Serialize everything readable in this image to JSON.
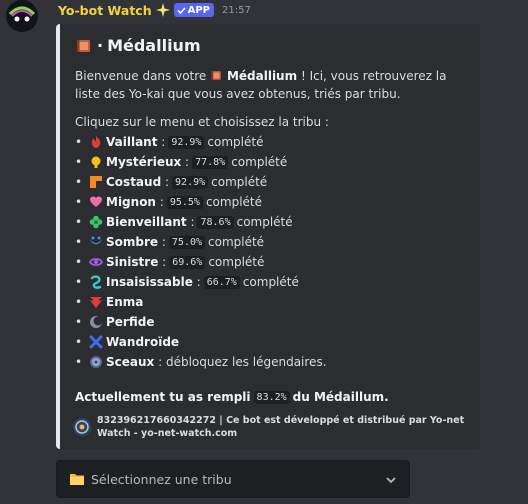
{
  "bot": {
    "name": "Yo-bot Watch",
    "badge": "APP",
    "timestamp": "21:57"
  },
  "embed": {
    "title_separator": "·",
    "title": "Médallium",
    "description_intro": "Bienvenue dans votre",
    "description_bold": "Médallium",
    "description_rest": "! Ici, vous retrouverez la liste des Yo-kai que vous avez obtenus, triés par tribu.",
    "instruction": "Cliquez sur le menu et choisissez la tribu :",
    "tribes": [
      {
        "name": "Vaillant",
        "percent": "92.9%",
        "suffix": "complété",
        "icon": "flame-icon",
        "color": "#e03a3a"
      },
      {
        "name": "Mystérieux",
        "percent": "77.8%",
        "suffix": "complété",
        "icon": "bulb-icon",
        "color": "#f0c419"
      },
      {
        "name": "Costaud",
        "percent": "92.9%",
        "suffix": "complété",
        "icon": "block-icon",
        "color": "#f08a24"
      },
      {
        "name": "Mignon",
        "percent": "95.5%",
        "suffix": "complété",
        "icon": "heart-icon",
        "color": "#f26ea7"
      },
      {
        "name": "Bienveillant",
        "percent": "78.6%",
        "suffix": "complété",
        "icon": "flower-icon",
        "color": "#3cc46a"
      },
      {
        "name": "Sombre",
        "percent": "75.0%",
        "suffix": "complété",
        "icon": "wave-icon",
        "color": "#3f8ef0"
      },
      {
        "name": "Sinistre",
        "percent": "69.6%",
        "suffix": "complété",
        "icon": "eye-icon",
        "color": "#a35ee8"
      },
      {
        "name": "Insaisissable",
        "percent": "66.7%",
        "suffix": "complété",
        "icon": "swirl-icon",
        "color": "#39c7d6"
      },
      {
        "name": "Enma",
        "percent": "",
        "suffix": "",
        "icon": "enma-icon",
        "color": "#e03a3a"
      },
      {
        "name": "Perfide",
        "percent": "",
        "suffix": "",
        "icon": "crescent-icon",
        "color": "#8a8fa8"
      },
      {
        "name": "Wandroïde",
        "percent": "",
        "suffix": "",
        "icon": "x-icon",
        "color": "#3f6ef0"
      },
      {
        "name": "Sceaux",
        "percent": "",
        "suffix": ": débloquez les légendaires.",
        "icon": "seal-icon",
        "color": "#9aa8c8"
      }
    ],
    "summary_prefix": "Actuellement tu as rempli",
    "summary_percent": "83.2%",
    "summary_suffix": "du Médaillum.",
    "footer": "832396217660342272 | Ce bot est développé et distribué par Yo-net Watch - yo-net-watch.com"
  },
  "select_menu": {
    "placeholder": "Sélectionnez une tribu",
    "icon": "folder-icon"
  }
}
